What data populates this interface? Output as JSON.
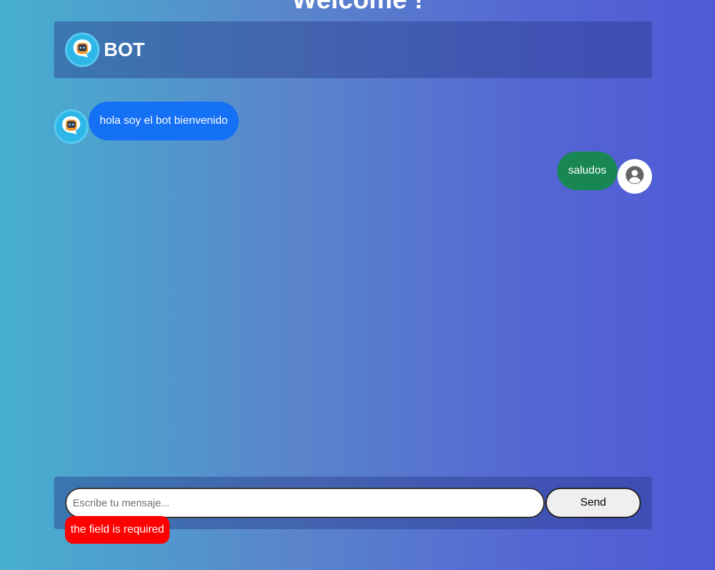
{
  "page": {
    "title": "Welcome !"
  },
  "header": {
    "bot_name": "BOT",
    "avatar_icon": "robot-chat-icon"
  },
  "messages": [
    {
      "sender": "bot",
      "text": "hola soy el bot bienvenido",
      "avatar_icon": "robot-chat-icon"
    },
    {
      "sender": "user",
      "text": "saludos",
      "avatar_icon": "user-circle-icon"
    }
  ],
  "composer": {
    "placeholder": "Escribe tu mensaje...",
    "value": "",
    "send_label": "Send",
    "error": "the field is required"
  },
  "colors": {
    "bot_bubble": "#1470f5",
    "user_bubble": "#198754",
    "error": "#ff0000"
  }
}
